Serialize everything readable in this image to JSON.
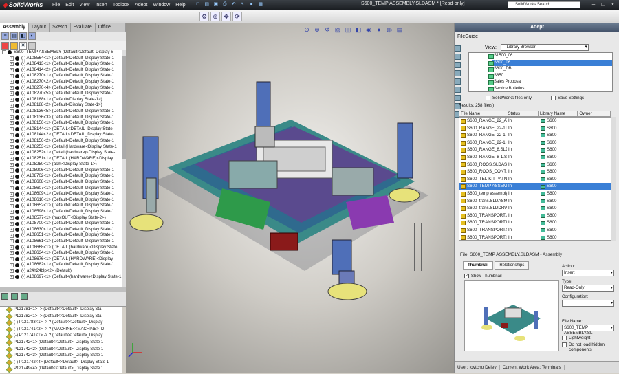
{
  "app": {
    "name": "SolidWorks",
    "doc_title": "S600_TEMP ASSEMBLY.SLDASM * [Read-only]"
  },
  "menus": [
    "File",
    "Edit",
    "View",
    "Insert",
    "Toolbox",
    "Adept",
    "Window",
    "Help"
  ],
  "search": {
    "placeholder": "SolidWorks Search"
  },
  "left_tabs": [
    "Assembly",
    "Layout",
    "Sketch",
    "Evaluate",
    "Office Products"
  ],
  "tree": {
    "root": "S600_TEMP ASSEMBLY  (Default<Default_Display S",
    "items": [
      "(-) A108564<1> (Default<Default_Display State-1",
      "(-) A108413<1> (Default<Default_Display State-1",
      "(-) A108414<2> (Default<Default_Display State-1",
      "(-) A108270<1> (Default<Default_Display State-1",
      "(-) A108270<2> (Default<Default_Display State-1",
      "(-) A108270<4> (Default<Default_Display State-1",
      "(-) A108270<5> (Default<Default_Display State-1",
      "(-) A108188<1> (Default<Display State-1>)",
      "(-) A108188<2> (Default<Display State-1>)",
      "(-) A108136<5> (Default<Default_Display State-1",
      "(-) A108136<3> (Default<Default_Display State-1",
      "(-) A108156<1> (Default<Default_Display State-1",
      "(-) A108144<1> (DETAIL<DETAIL_Display State-",
      "(-) A108144<2> (DETAIL<DETAIL_Display State-",
      "(-) A108156<2> (Default<Default_Display State-1",
      "(-) A108253<1> (Detail (Hardware<Display State-1",
      "(-) A108252<1> (Detail (hardware)<Display State-",
      "(-) A108251<1> (DETAIL (HARDWARE)<Display",
      "(-) A108250<1> (asm<Display State-1>)",
      "(-) A108906<1> (Default<Default_Display State-1",
      "(-) A108702<1> (Default<Default_Display State-1",
      "(-) A108608<1> (Default<Default_Display State-1",
      "(-) A108607<1> (Default<Default_Display State-1",
      "(-) A108609<1> (Default<Default_Display State-1",
      "(-) A108610<1> (Default<Default_Display State-1",
      "(-) A108652<1> (Default<Default_Display State-1",
      "(-) A108598<1> (Default<Default_Display State-1",
      "(-) A108577<1> (maxOUT<Display State-2>)",
      "(-) A108700<1> (Default<Default_Display State-1",
      "(-) A108630<1> (Default<Default_Display State-1",
      "(-) A108651<1> (Default<Default_Display State-1",
      "(-) A108661<1> (Default<Default_Display State-1",
      "(-) A108668<1> (DETAIL (hardware)<Display State",
      "(-) A108634<1> (Default<Default_Display State-1",
      "(-) A108676<1> (DETAIL (HARDWARE)<Display",
      "(-) A108682<1> (Default<Default_Display State-1",
      "(-) a24h24blp<2> (Default)",
      "(-) A108697<1> (Default<(hardware)<Display State-1"
    ]
  },
  "bottom_tree": {
    "items": [
      "P121781<1> -> (Default<<Default>_Display Sta",
      "P121782<1> -> (Default<<Default>_Display Sta",
      "(-) P121783<1> -> ? (Default<<Default>_Display",
      "(-) P121741<2> -> ? (MACHINE<<MACHINE>_D",
      "(-) P121741<1> -> ? (Default<<Default>_Display",
      "P121742<1> (Default<<Default>_Display State 1",
      "P121742<2> (Default<<Default>_Display State 1",
      "P121742<3> (Default<<Default>_Display State 1",
      "(-) P121742<4> (Default<<Default>_Display State 1",
      "P121749<4> (Default<<Default>_Display State 1"
    ]
  },
  "adept": {
    "header": "Adept",
    "fileguide": "FileGuide",
    "view_label": "View:",
    "view_value": "-- Library Browser --",
    "library": [
      "S1500_06",
      "S600_06",
      "S600_DBI",
      "S850",
      "Sales Proposal",
      "Service Bulletins"
    ],
    "library_selected_index": 1,
    "chk_sw_only": "SolidWorks files only",
    "chk_save_settings": "Save Settings",
    "results": "Results: 258 file(s)",
    "columns": [
      "File Name",
      "Status",
      "Library Name",
      "Owner"
    ],
    "rows": [
      {
        "name": "S600_RANGE_22_ATTE",
        "status": "In",
        "lib": "S600"
      },
      {
        "name": "S600_RANGE_22-1.be",
        "status": "In",
        "lib": "S600"
      },
      {
        "name": "S600_RANGE_22-1.D\\",
        "status": "In",
        "lib": "S600"
      },
      {
        "name": "S600_RANGE_22-1.SL",
        "status": "In",
        "lib": "S600"
      },
      {
        "name": "S600_RANGE_8.SLDAS",
        "status": "In",
        "lib": "S600"
      },
      {
        "name": "S600_RANGE_8-1.SLD",
        "status": "In",
        "lib": "S600"
      },
      {
        "name": "S600_ROOS.SLDASM",
        "status": "In",
        "lib": "S600"
      },
      {
        "name": "S600_ROOS_CONT1.",
        "status": "In",
        "lib": "S600"
      },
      {
        "name": "S600_TEL-KIT-PATN.F",
        "status": "In",
        "lib": "S600"
      },
      {
        "name": "S600_TEMP ASSEMB",
        "status": "In",
        "lib": "S600"
      },
      {
        "name": "S600_temp assembly.",
        "status": "In",
        "lib": "S600"
      },
      {
        "name": "S600_trans.SLDASM",
        "status": "In",
        "lib": "S600"
      },
      {
        "name": "S600_trans.SLDDRW",
        "status": "In",
        "lib": "S600"
      },
      {
        "name": "S600_TRANSPORT.JP",
        "status": "In",
        "lib": "S600"
      },
      {
        "name": "S600_TRANSPORT.PI",
        "status": "In",
        "lib": "S600"
      },
      {
        "name": "S600_TRANSPORT.SL",
        "status": "In",
        "lib": "S600"
      },
      {
        "name": "S600_TRANSPORT.SL",
        "status": "In",
        "lib": "S600"
      }
    ],
    "selected_row": 9,
    "file_label": "File: S600_TEMP ASSEMBLY.SLDASM - Assembly",
    "tab_thumbnail": "Thumbnail",
    "tab_relationships": "Relationships",
    "show_thumbnail": "Show Thumbnail",
    "action_label": "Action:",
    "action_value": "Insert",
    "type_label": "Type:",
    "type_value": "Read-Only",
    "config_label": "Configuration:",
    "config_value": "",
    "filename_label": "File Name:",
    "filename_value": "S600_TEMP ASSEMBLY.SL",
    "lightweight": "Lightweight",
    "no_hidden": "Do not load hidden components",
    "status_user": "User: Iovtcho Delev",
    "status_area": "Current Work Area: Terminals"
  }
}
